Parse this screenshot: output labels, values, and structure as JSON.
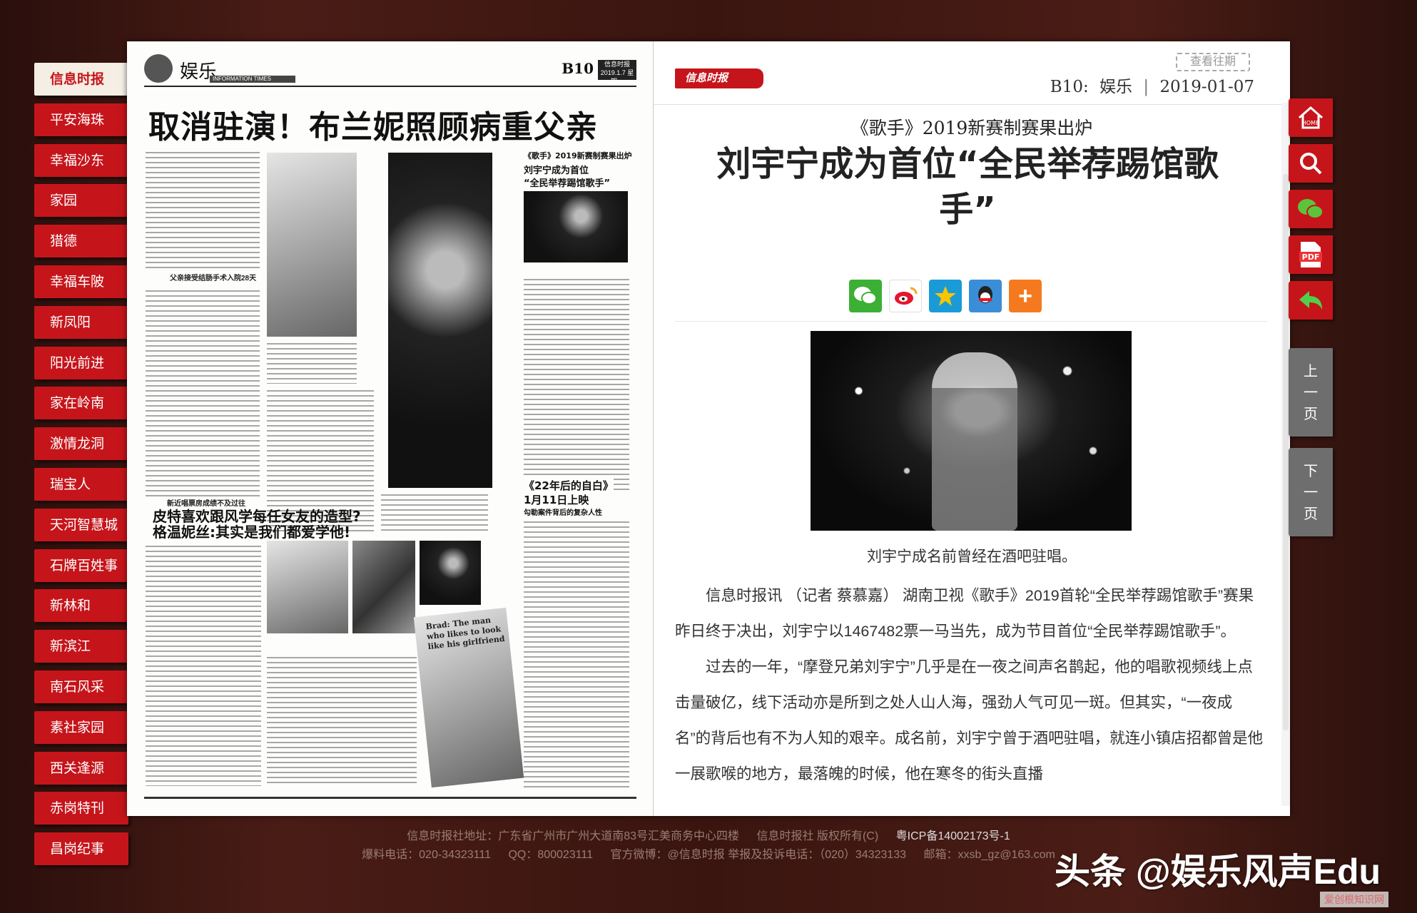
{
  "sidebar": {
    "items": [
      {
        "label": "信息时报",
        "active": true
      },
      {
        "label": "平安海珠"
      },
      {
        "label": "幸福沙东"
      },
      {
        "label": "家园"
      },
      {
        "label": "猎德"
      },
      {
        "label": "幸福车陂"
      },
      {
        "label": "新凤阳"
      },
      {
        "label": "阳光前进"
      },
      {
        "label": "家在岭南"
      },
      {
        "label": "激情龙洞"
      },
      {
        "label": "瑞宝人"
      },
      {
        "label": "天河智慧城"
      },
      {
        "label": "石牌百姓事"
      },
      {
        "label": "新林和"
      },
      {
        "label": "新滨江"
      },
      {
        "label": "南石风采"
      },
      {
        "label": "素社家园"
      },
      {
        "label": "西关逢源"
      },
      {
        "label": "赤岗特刊"
      },
      {
        "label": "昌岗纪事"
      }
    ]
  },
  "newspaper": {
    "section": "娱乐",
    "bar_text": "INFORMATION TIMES",
    "page": "B10",
    "tag": "信息时报 2019.1.7 星期一",
    "headline": "取消驻演！布兰妮照顾病重父亲",
    "sub1_line1": "皮特喜欢跟风学每任女友的造型?",
    "sub1_line2": "格温妮丝:其实是我们都爱学他!",
    "side_title1": "《歌手》2019新赛制赛果出炉",
    "side_title2": "刘宇宁成为首位",
    "side_title3": "“全民举荐踢馆歌手”",
    "side2_title1": "《22年后的自白》",
    "side2_title2": "1月11日上映",
    "side2_sub": "勾勒案件背后的复杂人性",
    "cap1": "父亲接受结肠手术入院28天",
    "cap2": "新近唱票房成绩不及过往",
    "overlay_text": "Brad: The man who likes to look like his girlfriend"
  },
  "article": {
    "logo": "信息时报",
    "history_button": "查看往期",
    "page_code": "B10:",
    "section": "娱乐",
    "date": "2019-01-07",
    "pre_title": "《歌手》2019新赛制赛果出炉",
    "title": "刘宇宁成为首位“全民举荐踢馆歌手”",
    "share_icons": [
      "wechat-icon",
      "weibo-icon",
      "qzone-icon",
      "qq-icon",
      "more-icon"
    ],
    "photo_caption": "刘宇宁成名前曾经在酒吧驻唱。",
    "paragraphs": [
      "信息时报讯 （记者 蔡慕嘉） 湖南卫视《歌手》2019首轮“全民举荐踢馆歌手”赛果昨日终于决出，刘宇宁以1467482票一马当先，成为节目首位“全民举荐踢馆歌手”。",
      "过去的一年，“摩登兄弟刘宇宁”几乎是在一夜之间声名鹊起，他的唱歌视频线上点击量破亿，线下活动亦是所到之处人山人海，强劲人气可见一斑。但其实，“一夜成名”的背后也有不为人知的艰辛。成名前，刘宇宁曾于酒吧驻唱，就连小镇店招都曾是他一展歌喉的地方，最落魄的时候，他在寒冬的街头直播"
    ]
  },
  "tools": {
    "home_label": "HOME",
    "pdf_label": "PDF",
    "prev_page": "上一页",
    "next_page": "下一页"
  },
  "footer": {
    "line1_address": "信息时报社地址：广东省广州市广州大道南83号汇美商务中心四楼",
    "line1_copyright": "信息时报社 版权所有(C)",
    "line1_icp": "粤ICP备14002173号-1",
    "line2_hotline": "爆料电话：020-34323111",
    "line2_qq": "QQ：800023111",
    "line2_weibo": "官方微博：@信息时报 举报及投诉电话：（020）34323133",
    "line2_email": "邮箱：xxsb_gz@163.com"
  },
  "watermark": "头条 @娱乐风声Edu",
  "corner_mark": "爱创根知识网",
  "colors": {
    "accent": "#c5151b",
    "background": "#3a1510",
    "pager": "#6e6e6e"
  }
}
